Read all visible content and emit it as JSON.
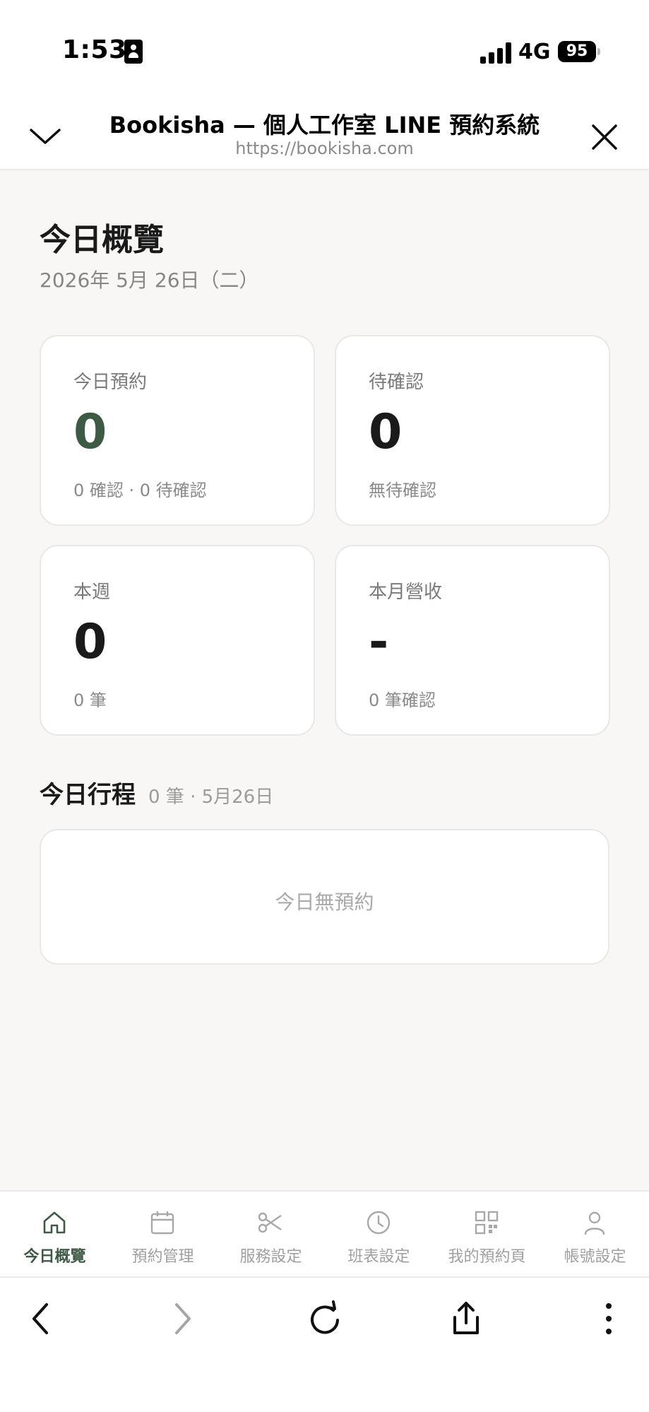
{
  "status_bar": {
    "time": "1:53",
    "network": "4G",
    "battery": "95"
  },
  "browser_header": {
    "title": "Bookisha — 個人工作室 LINE 預約系統",
    "url": "https://bookisha.com"
  },
  "overview": {
    "title": "今日概覽",
    "date": "2026年 5月 26日（二）"
  },
  "cards": [
    {
      "label": "今日預約",
      "value": "0",
      "sub": "0 確認 · 0 待確認"
    },
    {
      "label": "待確認",
      "value": "0",
      "sub": "無待確認"
    },
    {
      "label": "本週",
      "value": "0",
      "sub": "0 筆"
    },
    {
      "label": "本月營收",
      "value": "-",
      "sub": "0 筆確認"
    }
  ],
  "schedule": {
    "title": "今日行程",
    "meta": "0 筆 · 5月26日",
    "empty_text": "今日無預約"
  },
  "bottom_nav": [
    {
      "label": "今日概覽",
      "icon": "home-icon",
      "active": true
    },
    {
      "label": "預約管理",
      "icon": "calendar-icon",
      "active": false
    },
    {
      "label": "服務設定",
      "icon": "scissors-icon",
      "active": false
    },
    {
      "label": "班表設定",
      "icon": "clock-icon",
      "active": false
    },
    {
      "label": "我的預約頁",
      "icon": "qr-code-icon",
      "active": false
    },
    {
      "label": "帳號設定",
      "icon": "user-icon",
      "active": false
    }
  ],
  "toolbar_icons": [
    "back-arrow-icon",
    "forward-arrow-icon",
    "reload-icon",
    "share-icon",
    "more-vertical-icon"
  ],
  "colors": {
    "accent": "#3d5a45",
    "background": "#f8f7f5",
    "card_border": "#e9e8e5",
    "muted_text": "#8a8a8a"
  }
}
